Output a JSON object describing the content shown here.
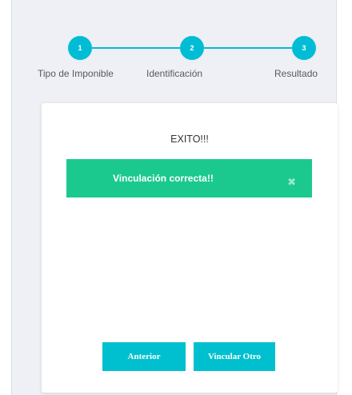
{
  "stepper": {
    "steps": [
      {
        "number": "1",
        "label": "Tipo de Imponible"
      },
      {
        "number": "2",
        "label": "Identificación"
      },
      {
        "number": "3",
        "label": "Resultado"
      }
    ]
  },
  "card": {
    "title": "EXITO!!!",
    "alert": {
      "message": "Vinculación correcta!!",
      "close_glyph": "✖"
    },
    "buttons": {
      "previous_label": "Anterior",
      "link_another_label": "Vincular Otro"
    }
  },
  "colors": {
    "accent": "#00bcd4",
    "success": "#1bc98e",
    "background": "#eef0f5"
  }
}
